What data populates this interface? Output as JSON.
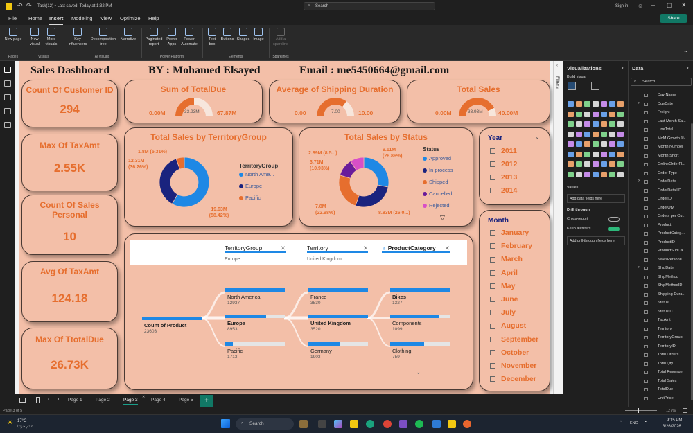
{
  "window": {
    "title": "Task(12) • Last saved: Today at 1:32 PM",
    "search": "Search",
    "signin": "Sign in",
    "share": "Share"
  },
  "menu": [
    "File",
    "Home",
    "Insert",
    "Modeling",
    "View",
    "Optimize",
    "Help"
  ],
  "ribbon": {
    "buttons": [
      "New page",
      "New visual",
      "More visuals",
      "Key influencers",
      "Decomposition tree",
      "Narrative",
      "Paginated report",
      "Power Apps",
      "Power Automate",
      "Text box",
      "Buttons",
      "Shapes",
      "Image",
      "Add a sparkline"
    ],
    "groups": [
      "Pages",
      "Visuals",
      "AI visuals",
      "Power Platform",
      "Elements",
      "Sparklines"
    ]
  },
  "header": {
    "title": "Sales Dashboard",
    "by": "BY : Mohamed Elsayed",
    "email": "Email : me5450664@gmail.com"
  },
  "kpis": [
    {
      "title": "Count Of Customer ID",
      "value": "294"
    },
    {
      "title": "Max Of TaxAmt",
      "value": "2.55K"
    },
    {
      "title": "Count Of Sales Personal",
      "value": "10"
    },
    {
      "title": "Avg Of TaxAmt",
      "value": "124.18"
    },
    {
      "title": "Max Of TtotalDue",
      "value": "26.73K"
    }
  ],
  "gauges": [
    {
      "title": "Sum of TotalDue",
      "min": "0.00M",
      "max": "67.87M",
      "value": "33.93M",
      "fraction": 0.5
    },
    {
      "title": "Average of Shipping Duration",
      "min": "0.00",
      "max": "10.00",
      "value": "7.00",
      "fraction": 0.7
    },
    {
      "title": "Total Sales",
      "min": "0.00M",
      "max": "40.00M",
      "value": "33.93M",
      "fraction": 0.85
    }
  ],
  "chart_data": [
    {
      "type": "pie",
      "title": "Total Sales by TerritoryGroup",
      "legend_title": "TerritoryGroup",
      "categories": [
        "North Ame...",
        "Europe",
        "Pacific"
      ],
      "values": [
        19.63,
        12.31,
        1.8
      ],
      "labels": [
        "19.63M (58.42%)",
        "12.31M (36.26%)",
        "1.8M (5.31%)"
      ],
      "colors": [
        "#1e88e5",
        "#1a237e",
        "#e66e2e"
      ]
    },
    {
      "type": "pie",
      "title": "Total Sales by Status",
      "legend_title": "Status",
      "categories": [
        "Approved",
        "In process",
        "Shipped",
        "Cancelled",
        "Rejected"
      ],
      "values": [
        9.11,
        8.83,
        7.8,
        3.71,
        2.89
      ],
      "labels": [
        "9.11M (26.86%)",
        "8.83M (26.0...)",
        "7.8M (22.98%)",
        "3.71M (10.93%)",
        "2.89M (8.5...)"
      ],
      "colors": [
        "#1e88e5",
        "#1a237e",
        "#e66e2e",
        "#6a1b9a",
        "#d84fc7"
      ]
    }
  ],
  "slicers": {
    "year": {
      "title": "Year",
      "items": [
        "2011",
        "2012",
        "2013",
        "2014"
      ]
    },
    "month": {
      "title": "Month",
      "items": [
        "January",
        "February",
        "March",
        "April",
        "May",
        "June",
        "July",
        "August",
        "September",
        "October",
        "November",
        "December"
      ]
    }
  },
  "decomp": {
    "headers": [
      {
        "label": "TerritoryGroup",
        "value": "Europe"
      },
      {
        "label": "Territory",
        "value": "United Kingdom"
      },
      {
        "label": "ProductCategory",
        "value": ""
      }
    ],
    "root": {
      "label": "Count of Product",
      "value": "23603"
    },
    "level1": [
      {
        "label": "North America",
        "value": "12937",
        "fill": 1.0
      },
      {
        "label": "Europe",
        "value": "8953",
        "fill": 0.69,
        "selected": true
      },
      {
        "label": "Pacific",
        "value": "1713",
        "fill": 0.13
      }
    ],
    "level2": [
      {
        "label": "France",
        "value": "3530",
        "fill": 1.0
      },
      {
        "label": "United Kingdom",
        "value": "3520",
        "fill": 1.0,
        "selected": true
      },
      {
        "label": "Germany",
        "value": "1903",
        "fill": 0.54
      }
    ],
    "level3": [
      {
        "label": "Bikes",
        "value": "1327",
        "fill": 1.0,
        "selected": true
      },
      {
        "label": "Components",
        "value": "1099",
        "fill": 0.83
      },
      {
        "label": "Clothing",
        "value": "759",
        "fill": 0.57
      }
    ]
  },
  "filters_label": "Filters",
  "viz": {
    "title": "Visualizations",
    "build": "Build visual",
    "values": "Values",
    "add_fields": "Add data fields here",
    "drill": "Drill through",
    "cross": "Cross-report",
    "keep": "Keep all filters",
    "add_drill": "Add drill-through fields here"
  },
  "data": {
    "title": "Data",
    "search": "Search",
    "fields": [
      "Day Name",
      "DueDate",
      "Freight",
      "Last Month Sa...",
      "LineTotal",
      "MoM Growth %",
      "Month Number",
      "Month Short",
      "OnlineOrderFl...",
      "Order Type",
      "OrderDate",
      "OrderDetailID",
      "OrderID",
      "OrderQty",
      "Orders per Cu...",
      "Product",
      "ProductCateg...",
      "ProductID",
      "ProductSubCa...",
      "SalesPersonID",
      "ShipDate",
      "ShipMethod",
      "ShipMethodID",
      "Shipping Dura...",
      "Status",
      "StatusID",
      "TaxAmt",
      "Territory",
      "TerritoryGroup",
      "TerritoryID",
      "Total Orders",
      "Total Qty",
      "Total Revenue",
      "Total Sales",
      "TotalDue",
      "UnitPrice"
    ]
  },
  "pages": [
    "Page 1",
    "Page 2",
    "Page 3",
    "Page 4",
    "Page 5"
  ],
  "status": {
    "page": "Page 3 of 5",
    "zoom": "127%"
  },
  "taskbar": {
    "temp": "17°C",
    "weather": "غائم جزئيًا",
    "search": "Search",
    "lang": "ENG",
    "time": "9:15 PM",
    "date": "3/26/2026"
  }
}
